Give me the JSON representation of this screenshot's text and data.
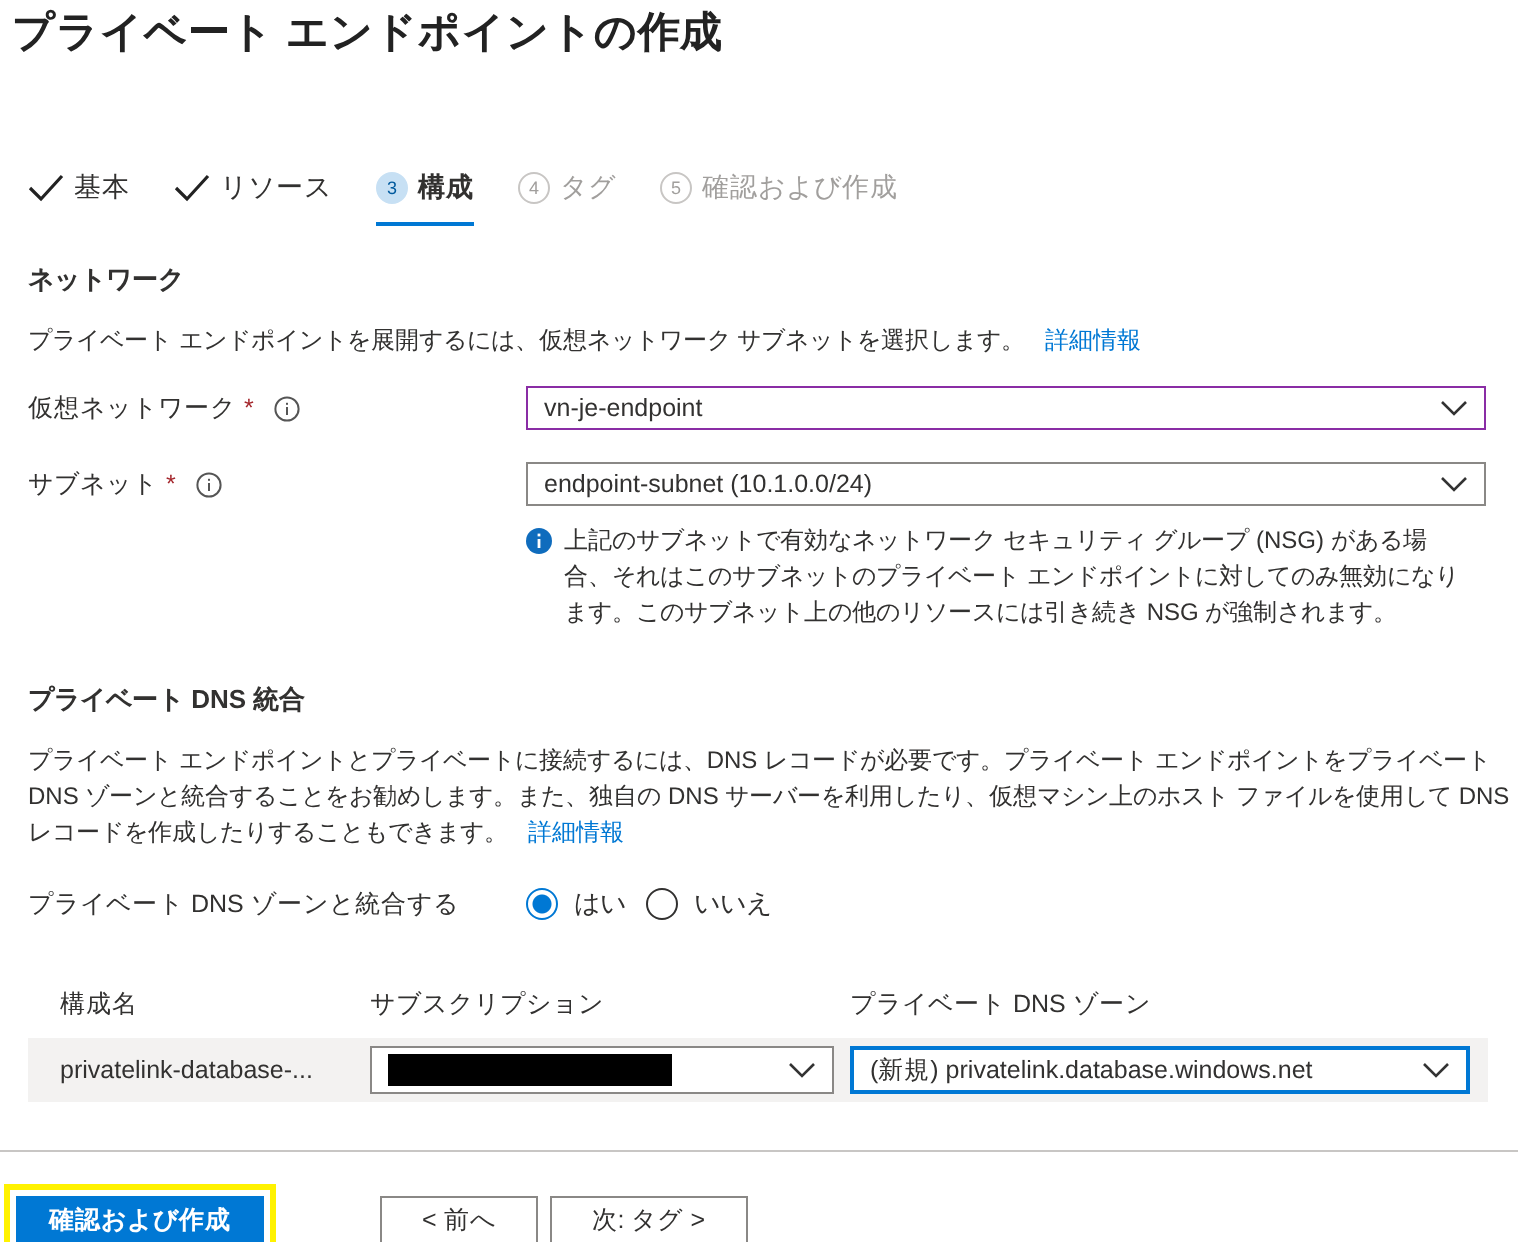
{
  "page": {
    "title": "プライベート エンドポイントの作成"
  },
  "tabs": [
    {
      "kind": "done",
      "label": "基本",
      "selected": false,
      "disabled": false
    },
    {
      "kind": "done",
      "label": "リソース",
      "selected": false,
      "disabled": false
    },
    {
      "kind": "step",
      "number": "3",
      "label": "構成",
      "selected": true,
      "disabled": false
    },
    {
      "kind": "step",
      "number": "4",
      "label": "タグ",
      "selected": false,
      "disabled": true
    },
    {
      "kind": "step",
      "number": "5",
      "label": "確認および作成",
      "selected": false,
      "disabled": true
    }
  ],
  "network": {
    "heading": "ネットワーク",
    "description": "プライベート エンドポイントを展開するには、仮想ネットワーク サブネットを選択します。",
    "link": "詳細情報",
    "fields": [
      {
        "label": "仮想ネットワーク",
        "required": true,
        "value": "vn-je-endpoint",
        "focused": true
      },
      {
        "label": "サブネット",
        "required": true,
        "value": "endpoint-subnet (10.1.0.0/24)",
        "focused": false
      }
    ],
    "required_mark": "*",
    "info": "上記のサブネットで有効なネットワーク セキュリティ グループ (NSG) がある場合、それはこのサブネットのプライベート エンドポイントに対してのみ無効になります。このサブネット上の他のリソースには引き続き NSG が強制されます。"
  },
  "dns": {
    "heading": "プライベート DNS 統合",
    "description": "プライベート エンドポイントとプライベートに接続するには、DNS レコードが必要です。プライベート エンドポイントをプライベート DNS ゾーンと統合することをお勧めします。また、独自の DNS サーバーを利用したり、仮想マシン上のホスト ファイルを使用して DNS レコードを作成したりすることもできます。",
    "link": "詳細情報",
    "integrate_label": "プライベート DNS ゾーンと統合する",
    "options": [
      {
        "label": "はい",
        "selected": true
      },
      {
        "label": "いいえ",
        "selected": false
      }
    ],
    "table": {
      "columns": [
        "構成名",
        "サブスクリプション",
        "プライベート DNS ゾーン"
      ],
      "rows": [
        {
          "name": "privatelink-database-...",
          "subscription_redacted": true,
          "zone": "(新規) privatelink.database.windows.net"
        }
      ]
    }
  },
  "footer": {
    "buttons": [
      {
        "kind": "primary",
        "label": "確認および作成",
        "highlighted": true
      },
      {
        "kind": "secondary",
        "label": "< 前へ",
        "highlighted": false
      },
      {
        "kind": "secondary",
        "label": "次: タグ >",
        "highlighted": false
      }
    ]
  }
}
